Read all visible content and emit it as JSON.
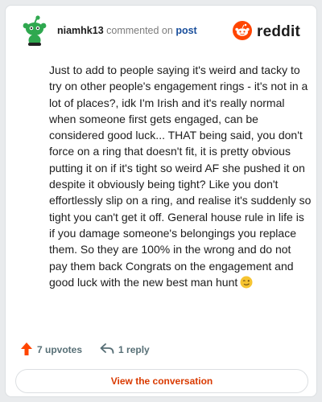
{
  "comment": {
    "username": "niamhk13",
    "verb": "commented on",
    "target": "post",
    "text": "Just to add to people saying it's weird and tacky to try on other people's engagement rings - it's not in a lot of places?, idk I'm Irish and it's really normal when someone first gets engaged, can be considered good luck... THAT being said, you don't force on a ring that doesn't fit, it is pretty obvious putting it on if it's tight so weird AF she pushed it on despite it obviously being tight? Like you don't effortlessly slip on a ring, and realise it's suddenly so tight you can't get it off. General house rule in life is if you damage someone's belongings you replace them. So they are 100% in the wrong and do not pay them back Congrats on the engagement and good luck with the new best man hunt"
  },
  "brand": {
    "wordmark": "reddit",
    "accent": "#ff4500"
  },
  "actions": {
    "upvotes": "7 upvotes",
    "replies": "1 reply"
  },
  "cta": {
    "label": "View the conversation"
  },
  "icons": {
    "avatar": "snoo-avatar-icon",
    "logo": "reddit-logo-icon",
    "upvote": "upvote-arrow-icon",
    "reply": "reply-arrow-icon",
    "emoji": "winking-face-emoji-icon"
  }
}
